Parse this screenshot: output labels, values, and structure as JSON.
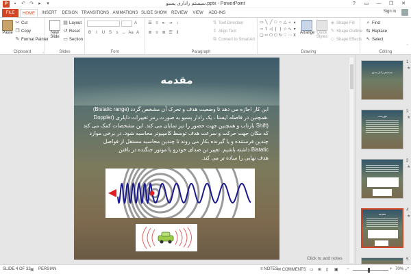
{
  "app": {
    "title": "سیستم راداری پسیو.pptx - PowerPoint",
    "logo": "P",
    "window_buttons": [
      "?",
      "▭",
      "—",
      "❐",
      "✕"
    ],
    "sign_in": "Sign in"
  },
  "tabs": [
    "FILE",
    "HOME",
    "INSERT",
    "DESIGN",
    "TRANSITIONS",
    "ANIMATIONS",
    "SLIDE SHOW",
    "REVIEW",
    "VIEW",
    "ADD-INS"
  ],
  "ribbon": {
    "clipboard": {
      "label": "Clipboard",
      "paste": "Paste",
      "cut": "Cut",
      "copy": "Copy",
      "format_painter": "Format Painter"
    },
    "slides": {
      "label": "Slides",
      "new_slide": "New Slide",
      "layout": "Layout",
      "reset": "Reset",
      "section": "Section"
    },
    "font": {
      "label": "Font"
    },
    "paragraph": {
      "label": "Paragraph",
      "text_direction": "Text Direction",
      "align_text": "Align Text",
      "convert_smartart": "Convert to SmartArt"
    },
    "drawing": {
      "label": "Drawing",
      "arrange": "Arrange",
      "quick_styles": "Quick Styles",
      "shape_fill": "Shape Fill",
      "shape_outline": "Shape Outline",
      "shape_effects": "Shape Effects"
    },
    "editing": {
      "label": "Editing",
      "find": "Find",
      "replace": "Replace",
      "select": "Select"
    }
  },
  "slide": {
    "title": "مقدمه",
    "body_lines": [
      "این کار اجازه می دهد تا وضعیت هدف و تحرک آن مشخص گردد (Bistatic range)",
      ".همچنین در فاصله ایستا ، یک رادار پسیو به صورت رمز تغییرات داپلری (Doppler",
      "(Shift بازتاب و همچنین جهت حضور را نیز نمایان می کند. این مشخصات کمک می کند",
      "که مکان جهت حرکت و سرعت هدف توسط کامپیوتر محاسبه شود. در برخی موارد",
      "چندین فرستنده و یا گیرنده بکار می روند تا چندین محاسبه مستقل از فواصل",
      "Bistatic داشته باشیم. تغییر تن صدای خودرو یا موتور جنگنده در باقتن",
      "هدف نهایی را ساده تر می کند."
    ]
  },
  "notes_hint": "Click to add notes",
  "thumbnails": [
    {
      "number": "1",
      "star": "★",
      "title": "سیستم رادار پسیو",
      "selected": false
    },
    {
      "number": "2",
      "star": "★",
      "title": "فهرست",
      "selected": false
    },
    {
      "number": "3",
      "star": "★",
      "title": "",
      "selected": false
    },
    {
      "number": "4",
      "star": "★",
      "title": "مقدمه",
      "selected": true
    },
    {
      "number": "5",
      "star": "",
      "title": "",
      "selected": false
    }
  ],
  "status": {
    "slide_of": "SLIDE 4 OF 32",
    "language": "PERSIAN",
    "notes": "NOTES",
    "comments": "COMMENTS",
    "zoom": "70%"
  },
  "colors": {
    "accent": "#d24726",
    "wave": "#1a1a8c",
    "marker": "#e02020"
  }
}
